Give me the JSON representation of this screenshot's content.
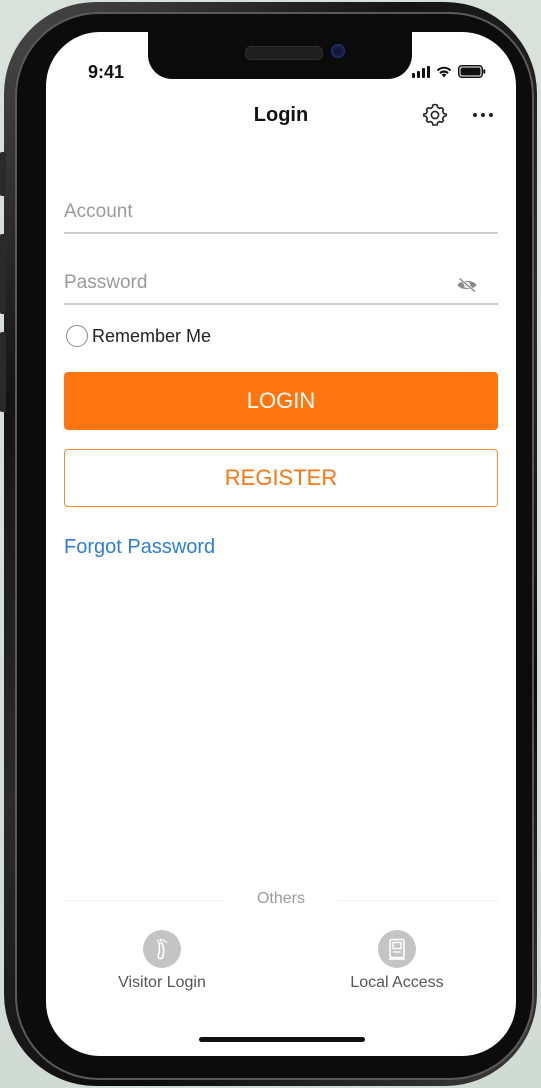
{
  "status_bar": {
    "time": "9:41"
  },
  "nav": {
    "title": "Login",
    "settings_icon": "gear-icon",
    "more_icon": "more-dots-icon"
  },
  "form": {
    "account_placeholder": "Account",
    "account_value": "",
    "password_placeholder": "Password",
    "password_value": "",
    "password_toggle_icon": "eye-off-icon",
    "remember_label": "Remember Me",
    "remember_checked": false
  },
  "buttons": {
    "login_label": "LOGIN",
    "register_label": "REGISTER"
  },
  "links": {
    "forgot_password": "Forgot Password"
  },
  "others": {
    "section_label": "Others",
    "items": [
      {
        "label": "Visitor Login",
        "icon": "footprint-icon"
      },
      {
        "label": "Local Access",
        "icon": "local-device-icon"
      }
    ]
  },
  "colors": {
    "accent": "#ff750f",
    "link": "#2d7fd2",
    "background": "#ffffff"
  }
}
